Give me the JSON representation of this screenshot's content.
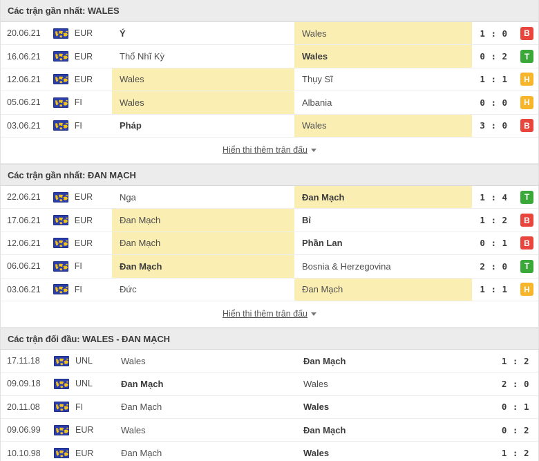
{
  "colors": {
    "highlight": "#fbeeb2",
    "header_bg": "#ececec",
    "badge_loss": "#e8453c",
    "badge_win": "#3aa93a",
    "badge_draw": "#f7b52c",
    "link": "#555555"
  },
  "show_more_label": "Hiển thị thêm trận đấu",
  "icons": {
    "competition": "globe-icon",
    "caret": "chevron-down-icon"
  },
  "sections": [
    {
      "title": "Các trận gần nhất: WALES",
      "has_badges": true,
      "has_show_more": true,
      "rows": [
        {
          "date": "20.06.21",
          "comp": "EUR",
          "home": "Ý",
          "away": "Wales",
          "score": "1 : 0",
          "badge": "B",
          "badge_type": "W",
          "home_bold": true,
          "away_bold": false,
          "home_hl": false,
          "away_hl": true
        },
        {
          "date": "16.06.21",
          "comp": "EUR",
          "home": "Thổ Nhĩ Kỳ",
          "away": "Wales",
          "score": "0 : 2",
          "badge": "T",
          "badge_type": "T",
          "home_bold": false,
          "away_bold": true,
          "home_hl": false,
          "away_hl": true
        },
        {
          "date": "12.06.21",
          "comp": "EUR",
          "home": "Wales",
          "away": "Thụy Sĩ",
          "score": "1 : 1",
          "badge": "H",
          "badge_type": "H",
          "home_bold": false,
          "away_bold": false,
          "home_hl": true,
          "away_hl": false
        },
        {
          "date": "05.06.21",
          "comp": "FI",
          "home": "Wales",
          "away": "Albania",
          "score": "0 : 0",
          "badge": "H",
          "badge_type": "H",
          "home_bold": false,
          "away_bold": false,
          "home_hl": true,
          "away_hl": false
        },
        {
          "date": "03.06.21",
          "comp": "FI",
          "home": "Pháp",
          "away": "Wales",
          "score": "3 : 0",
          "badge": "B",
          "badge_type": "W",
          "home_bold": true,
          "away_bold": false,
          "home_hl": false,
          "away_hl": true
        }
      ]
    },
    {
      "title": "Các trận gần nhất: ĐAN MẠCH",
      "has_badges": true,
      "has_show_more": true,
      "rows": [
        {
          "date": "22.06.21",
          "comp": "EUR",
          "home": "Nga",
          "away": "Đan Mạch",
          "score": "1 : 4",
          "badge": "T",
          "badge_type": "T",
          "home_bold": false,
          "away_bold": true,
          "home_hl": false,
          "away_hl": true
        },
        {
          "date": "17.06.21",
          "comp": "EUR",
          "home": "Đan Mạch",
          "away": "Bỉ",
          "score": "1 : 2",
          "badge": "B",
          "badge_type": "W",
          "home_bold": false,
          "away_bold": true,
          "home_hl": true,
          "away_hl": false
        },
        {
          "date": "12.06.21",
          "comp": "EUR",
          "home": "Đan Mạch",
          "away": "Phần Lan",
          "score": "0 : 1",
          "badge": "B",
          "badge_type": "W",
          "home_bold": false,
          "away_bold": true,
          "home_hl": true,
          "away_hl": false
        },
        {
          "date": "06.06.21",
          "comp": "FI",
          "home": "Đan Mạch",
          "away": "Bosnia & Herzegovina",
          "score": "2 : 0",
          "badge": "T",
          "badge_type": "T",
          "home_bold": true,
          "away_bold": false,
          "home_hl": true,
          "away_hl": false
        },
        {
          "date": "03.06.21",
          "comp": "FI",
          "home": "Đức",
          "away": "Đan Mạch",
          "score": "1 : 1",
          "badge": "H",
          "badge_type": "H",
          "home_bold": false,
          "away_bold": false,
          "home_hl": false,
          "away_hl": true
        }
      ]
    },
    {
      "title": "Các trận đối đầu: WALES - ĐAN MẠCH",
      "has_badges": false,
      "has_show_more": false,
      "rows": [
        {
          "date": "17.11.18",
          "comp": "UNL",
          "home": "Wales",
          "away": "Đan Mạch",
          "score": "1 : 2",
          "badge": "",
          "badge_type": "",
          "home_bold": false,
          "away_bold": true,
          "home_hl": false,
          "away_hl": false
        },
        {
          "date": "09.09.18",
          "comp": "UNL",
          "home": "Đan Mạch",
          "away": "Wales",
          "score": "2 : 0",
          "badge": "",
          "badge_type": "",
          "home_bold": true,
          "away_bold": false,
          "home_hl": false,
          "away_hl": false
        },
        {
          "date": "20.11.08",
          "comp": "FI",
          "home": "Đan Mạch",
          "away": "Wales",
          "score": "0 : 1",
          "badge": "",
          "badge_type": "",
          "home_bold": false,
          "away_bold": true,
          "home_hl": false,
          "away_hl": false
        },
        {
          "date": "09.06.99",
          "comp": "EUR",
          "home": "Wales",
          "away": "Đan Mạch",
          "score": "0 : 2",
          "badge": "",
          "badge_type": "",
          "home_bold": false,
          "away_bold": true,
          "home_hl": false,
          "away_hl": false
        },
        {
          "date": "10.10.98",
          "comp": "EUR",
          "home": "Đan Mạch",
          "away": "Wales",
          "score": "1 : 2",
          "badge": "",
          "badge_type": "",
          "home_bold": false,
          "away_bold": true,
          "home_hl": false,
          "away_hl": false
        }
      ]
    }
  ]
}
